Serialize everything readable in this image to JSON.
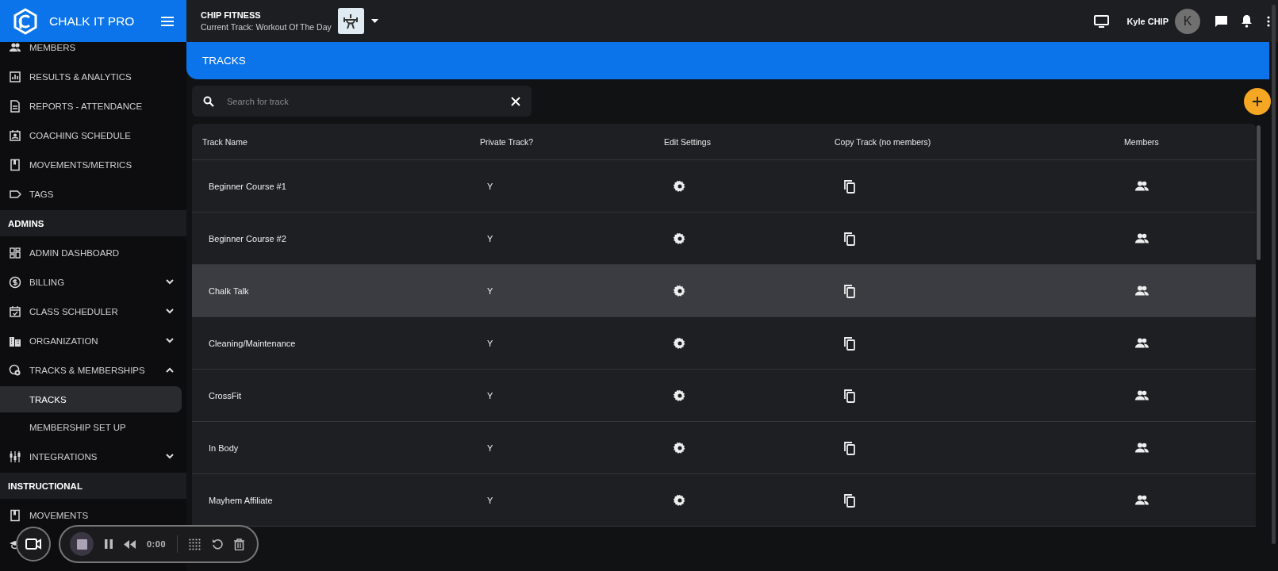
{
  "brand": {
    "name": "CHALK IT PRO"
  },
  "header": {
    "org": "CHIP FITNESS",
    "current_track": "Current Track: Workout Of The Day",
    "user": "Kyle CHIP",
    "avatar": "K"
  },
  "sidebar": {
    "items": [
      {
        "kind": "item",
        "label": "MEMBERS",
        "selected": false
      },
      {
        "kind": "item",
        "label": "RESULTS & ANALYTICS",
        "selected": false
      },
      {
        "kind": "item",
        "label": "REPORTS - ATTENDANCE",
        "selected": false
      },
      {
        "kind": "item",
        "label": "COACHING SCHEDULE",
        "selected": false
      },
      {
        "kind": "item",
        "label": "MOVEMENTS/METRICS",
        "selected": false
      },
      {
        "kind": "item",
        "label": "TAGS",
        "selected": false
      },
      {
        "kind": "section",
        "label": "ADMINS"
      },
      {
        "kind": "item",
        "label": "ADMIN DASHBOARD",
        "selected": false
      },
      {
        "kind": "group",
        "label": "BILLING",
        "expanded": false
      },
      {
        "kind": "group",
        "label": "CLASS SCHEDULER",
        "expanded": false
      },
      {
        "kind": "group",
        "label": "ORGANIZATION",
        "expanded": false
      },
      {
        "kind": "group",
        "label": "TRACKS & MEMBERSHIPS",
        "expanded": true
      },
      {
        "kind": "subitem",
        "label": "TRACKS",
        "selected": true
      },
      {
        "kind": "subitem",
        "label": "MEMBERSHIP SET UP",
        "selected": false
      },
      {
        "kind": "group",
        "label": "INTEGRATIONS",
        "expanded": false
      },
      {
        "kind": "section",
        "label": "INSTRUCTIONAL"
      },
      {
        "kind": "item",
        "label": "MOVEMENTS",
        "selected": false
      },
      {
        "kind": "item",
        "selected": false
      }
    ]
  },
  "page_title": "TRACKS",
  "search": {
    "placeholder": "Search for track"
  },
  "table": {
    "columns": [
      "Track Name",
      "Private Track?",
      "Edit Settings",
      "Copy Track (no members)",
      "Members"
    ],
    "rows": [
      {
        "name": "Beginner Course #1",
        "private": "Y",
        "selected": false
      },
      {
        "name": "Beginner Course #2",
        "private": "Y",
        "selected": false
      },
      {
        "name": "Chalk Talk",
        "private": "Y",
        "selected": true
      },
      {
        "name": "Cleaning/Maintenance",
        "private": "Y",
        "selected": false
      },
      {
        "name": "CrossFit",
        "private": "Y",
        "selected": false
      },
      {
        "name": "In Body",
        "private": "Y",
        "selected": false
      },
      {
        "name": "Mayhem Affiliate",
        "private": "Y",
        "selected": false
      }
    ]
  },
  "recorder": {
    "time": "0:00"
  }
}
